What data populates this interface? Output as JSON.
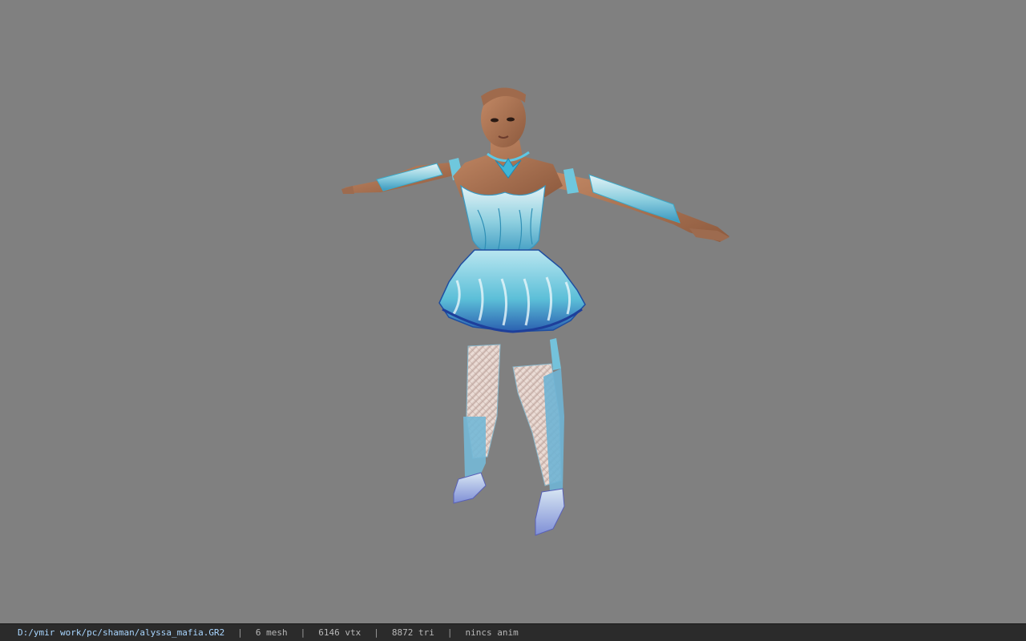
{
  "viewer": {
    "background_color": "#808080",
    "model_subject": "female character in turquoise petal dress, T-pose"
  },
  "status_bar": {
    "file_path": "D:/ymir work/pc/shaman/alyssa_mafia.GR2",
    "separator": "|",
    "mesh_count": "6 mesh",
    "vertex_count": "6146 vtx",
    "triangle_count": "8872 tri",
    "anim_status": "nincs anim"
  },
  "colors": {
    "skin": "#b57a58",
    "dress_light": "#bfe3ee",
    "dress_accent": "#3aa9c9",
    "dress_deep": "#2a66b8",
    "stocking": "#e7d3cc",
    "status_bg": "#2b2b2b",
    "status_text": "#b8b8b8"
  }
}
